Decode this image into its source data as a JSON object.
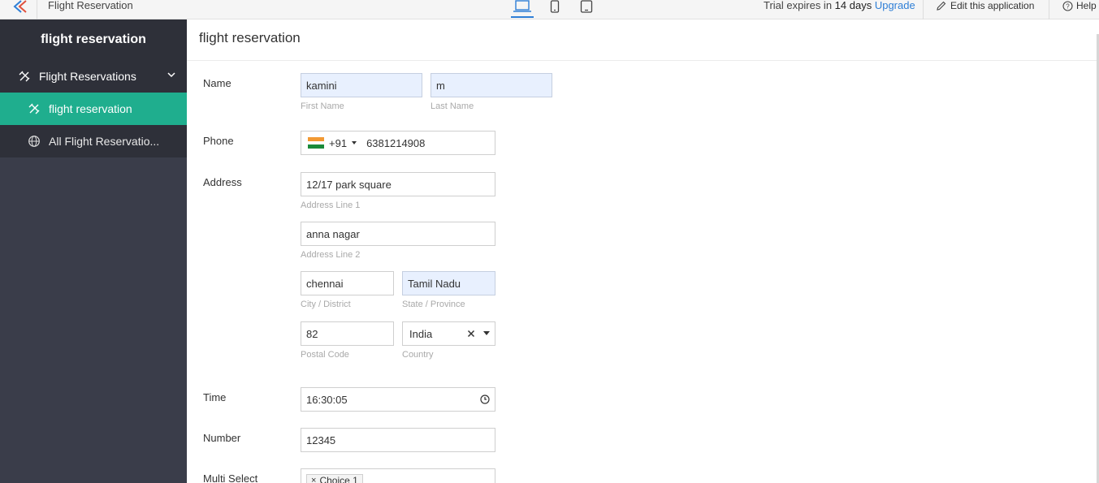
{
  "topbar": {
    "app_title": "Flight Reservation",
    "trial_prefix": "Trial expires in ",
    "trial_days": "14 days",
    "upgrade_label": "Upgrade",
    "edit_label": "Edit this application",
    "help_label": "Help"
  },
  "sidebar": {
    "brand": "flight reservation",
    "section_label": "Flight Reservations",
    "items": [
      {
        "label": "flight reservation",
        "icon": "form-icon",
        "active": true
      },
      {
        "label": "All Flight Reservatio...",
        "icon": "globe-icon",
        "active": false
      }
    ]
  },
  "main": {
    "title": "flight reservation",
    "fields": {
      "name": {
        "label": "Name",
        "first": "kamini",
        "last": "m",
        "first_hint": "First Name",
        "last_hint": "Last Name"
      },
      "phone": {
        "label": "Phone",
        "code": "+91",
        "number": "6381214908"
      },
      "address": {
        "label": "Address",
        "line1": "12/17 park square",
        "line1_hint": "Address Line 1",
        "line2": "anna nagar",
        "line2_hint": "Address Line 2",
        "city": "chennai",
        "city_hint": "City / District",
        "state": "Tamil Nadu",
        "state_hint": "State / Province",
        "postal": "82",
        "postal_hint": "Postal Code",
        "country": "India",
        "country_hint": "Country"
      },
      "time": {
        "label": "Time",
        "value": "16:30:05"
      },
      "number": {
        "label": "Number",
        "value": "12345"
      },
      "multi": {
        "label": "Multi Select",
        "chip": "Choice 1"
      }
    }
  },
  "colors": {
    "accent": "#1fae8e",
    "sidebar": "#3a3d4a",
    "link": "#2f7fd6"
  }
}
